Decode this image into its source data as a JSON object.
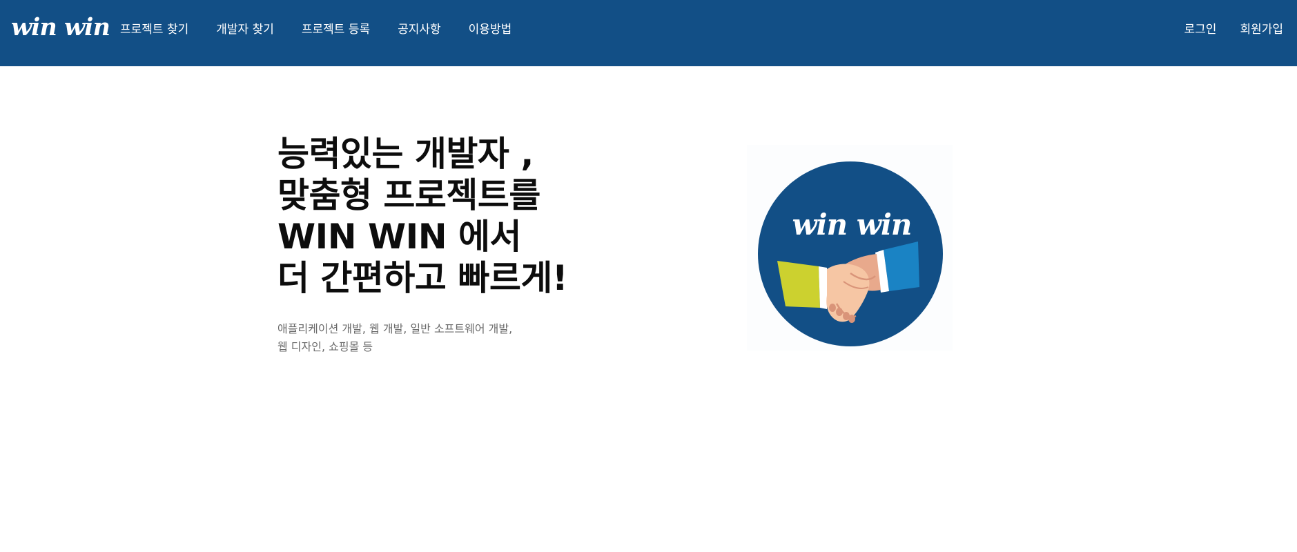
{
  "header": {
    "logo": "win win",
    "nav": [
      "프로젝트 찾기",
      "개발자 찾기",
      "프로젝트 등록",
      "공지사항",
      "이용방법"
    ],
    "auth": {
      "login": "로그인",
      "signup": "회원가입"
    }
  },
  "hero": {
    "title_lines": [
      "능력있는 개발자 ,",
      "맞춤형 프로젝트를",
      "WIN WIN 에서",
      "더 간편하고 빠르게!"
    ],
    "subtitle_lines": [
      "애플리케이션 개발, 웹 개발, 일반 소프트웨어 개발,",
      "웹 디자인, 쇼핑몰 등"
    ]
  },
  "illustration": {
    "logo_text": "win win",
    "icon": "handshake-icon"
  },
  "colors": {
    "brand": "#124f86",
    "header_text": "#ffffff",
    "title": "#0d0d0d",
    "subtitle": "#6a6a6a",
    "sleeve_left": "#ccd12f",
    "sleeve_right": "#1a83c4"
  }
}
